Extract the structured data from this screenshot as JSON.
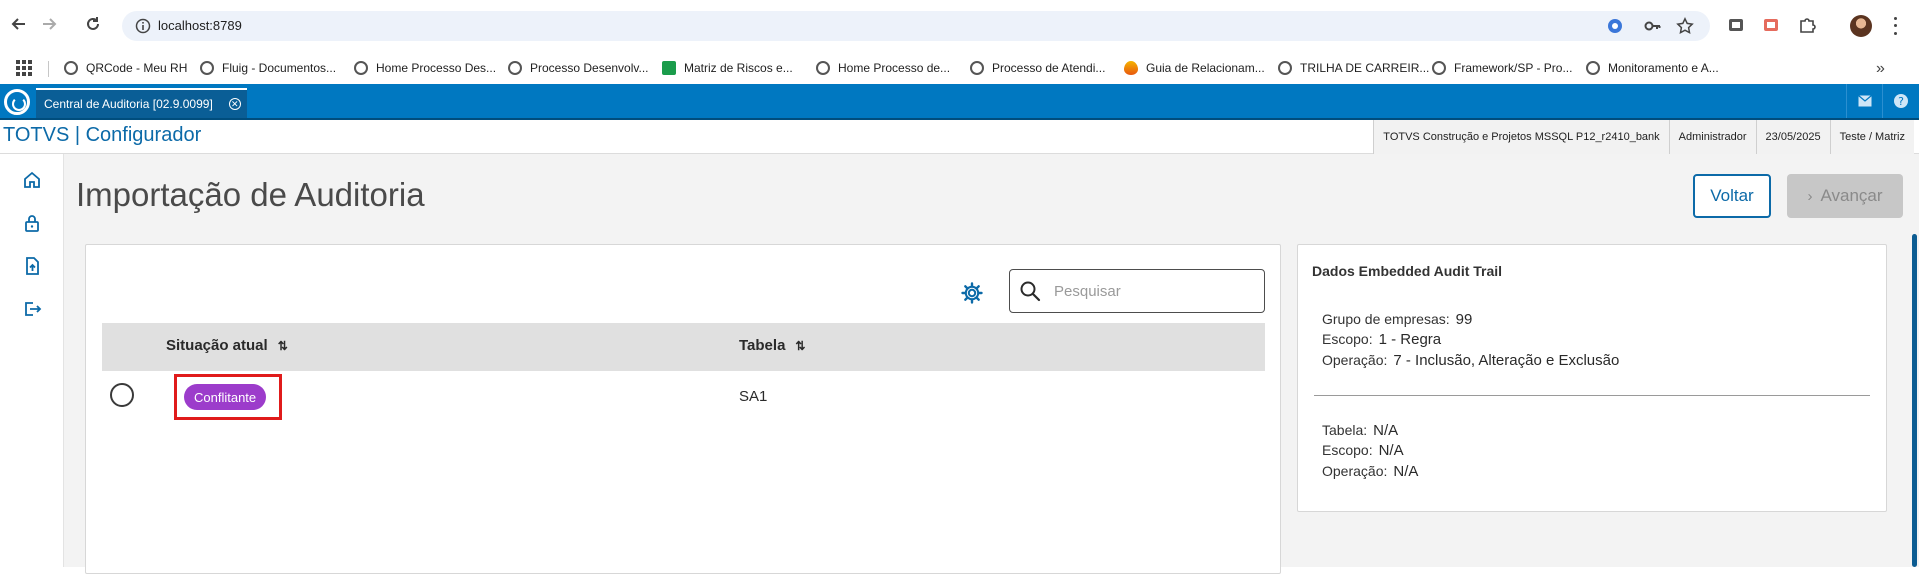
{
  "browser": {
    "url": "localhost:8789",
    "bookmarks": [
      {
        "label": "QRCode - Meu RH",
        "icon": "globe-icon"
      },
      {
        "label": "Fluig - Documentos...",
        "icon": "globe-icon"
      },
      {
        "label": "Home Processo Des...",
        "icon": "globe-icon"
      },
      {
        "label": "Processo Desenvolv...",
        "icon": "globe-icon"
      },
      {
        "label": "Matriz de Riscos e...",
        "icon": "sheets-icon"
      },
      {
        "label": "Home Processo de...",
        "icon": "globe-icon"
      },
      {
        "label": "Processo de Atendi...",
        "icon": "globe-icon"
      },
      {
        "label": "Guia de Relacionam...",
        "icon": "flame-icon"
      },
      {
        "label": "TRILHA DE CARREIR...",
        "icon": "globe-icon"
      },
      {
        "label": "Framework/SP - Pro...",
        "icon": "globe-icon"
      },
      {
        "label": "Monitoramento e A...",
        "icon": "globe-icon"
      }
    ],
    "bookmarks_more": "»"
  },
  "app": {
    "tab_label": "Central de Auditoria [02.9.0099]",
    "tab_close": "✕",
    "name": "TOTVS | Configurador",
    "status": {
      "environment": "TOTVS Construção e Projetos MSSQL P12_r2410_bank",
      "user": "Administrador",
      "date": "23/05/2025",
      "branch": "Teste / Matriz"
    }
  },
  "page": {
    "title": "Importação de Auditoria",
    "back_label": "Voltar",
    "next_label": "Avançar",
    "next_chevron": "›"
  },
  "table": {
    "search_placeholder": "Pesquisar",
    "columns": [
      "Situação atual",
      "Tabela"
    ],
    "sort_glyph": "⇅",
    "rows": [
      {
        "situacao": "Conflitante",
        "tabela": "SA1"
      }
    ]
  },
  "info_panel": {
    "title": "Dados Embedded Audit Trail",
    "group1": [
      {
        "label": "Grupo de empresas:",
        "value": "99"
      },
      {
        "label": "Escopo:",
        "value": "1 - Regra"
      },
      {
        "label": "Operação:",
        "value": "7 - Inclusão, Alteração e Exclusão"
      }
    ],
    "group2": [
      {
        "label": "Tabela:",
        "value": "N/A"
      },
      {
        "label": "Escopo:",
        "value": "N/A"
      },
      {
        "label": "Operação:",
        "value": "N/A"
      }
    ]
  },
  "colors": {
    "brand_blue": "#0078c1",
    "link_blue": "#0c6aa8",
    "tag_purple": "#9c3ccb",
    "highlight_red": "#e01b1b"
  }
}
